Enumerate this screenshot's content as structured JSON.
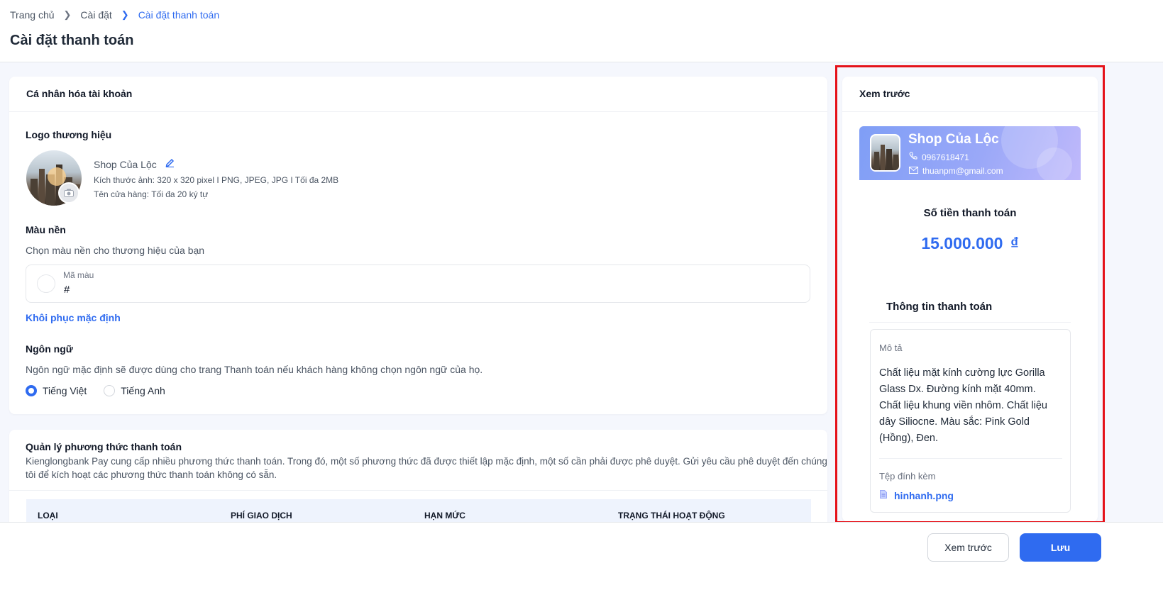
{
  "breadcrumb": {
    "items": [
      "Trang chủ",
      "Cài đặt",
      "Cài đặt thanh toán"
    ]
  },
  "page": {
    "title": "Cài đặt thanh toán"
  },
  "personalize": {
    "title": "Cá nhân hóa tài khoản",
    "logo_label": "Logo thương hiệu",
    "shop_name": "Shop Của Lộc",
    "image_spec": "Kích thước ảnh: 320 x 320 pixel I PNG, JPEG, JPG I Tối đa 2MB",
    "name_spec": "Tên cửa hàng: Tối đa 20 ký tự",
    "bg_label": "Màu nền",
    "bg_desc": "Chọn màu nền cho thương hiệu của bạn",
    "color_field_label": "Mã màu",
    "color_value": "#",
    "reset_link": "Khôi phục mặc định",
    "lang_label": "Ngôn ngữ",
    "lang_desc": "Ngôn ngữ mặc định sẽ được dùng cho trang Thanh toán nếu khách hàng không chọn ngôn ngữ của họ.",
    "lang_options": [
      "Tiếng Việt",
      "Tiếng Anh"
    ],
    "lang_selected": "Tiếng Việt"
  },
  "methods": {
    "title": "Quản lý phương thức thanh toán",
    "desc_line1": "Kienglongbank Pay cung cấp nhiều phương thức thanh toán. Trong đó, một số phương thức đã được thiết lập mặc định, một số cần phải được phê duyệt. Gửi yêu cầu phê duyệt đến chúng",
    "desc_line2": "tôi để kích hoạt các phương thức thanh toán không có sẵn.",
    "columns": [
      "LOẠI",
      "PHÍ GIAO DỊCH",
      "HẠN MỨC",
      "TRẠNG THÁI HOẠT ĐỘNG"
    ]
  },
  "preview": {
    "title": "Xem trước",
    "shop_name": "Shop Của Lộc",
    "phone": "0967618471",
    "email": "thuanpm@gmail.com",
    "amount_label": "Số tiền thanh toán",
    "amount": "15.000.000",
    "currency": "₫",
    "info_title": "Thông tin thanh toán",
    "desc_label": "Mô tả",
    "desc_lines": [
      "Chất liệu mặt kính cường lực Gorilla",
      "Glass Dx. Đường kính mặt 40mm.",
      "Chất liệu khung viền nhôm. Chất liệu",
      "dây Siliocne. Màu sắc: Pink Gold",
      "(Hồng), Đen."
    ],
    "attach_label": "Tệp đính kèm",
    "attach_file": "hinhanh.png"
  },
  "footer": {
    "preview_button": "Xem trước",
    "save_button": "Lưu"
  },
  "colors": {
    "primary": "#2f6bf0",
    "highlight": "#e5121a"
  }
}
